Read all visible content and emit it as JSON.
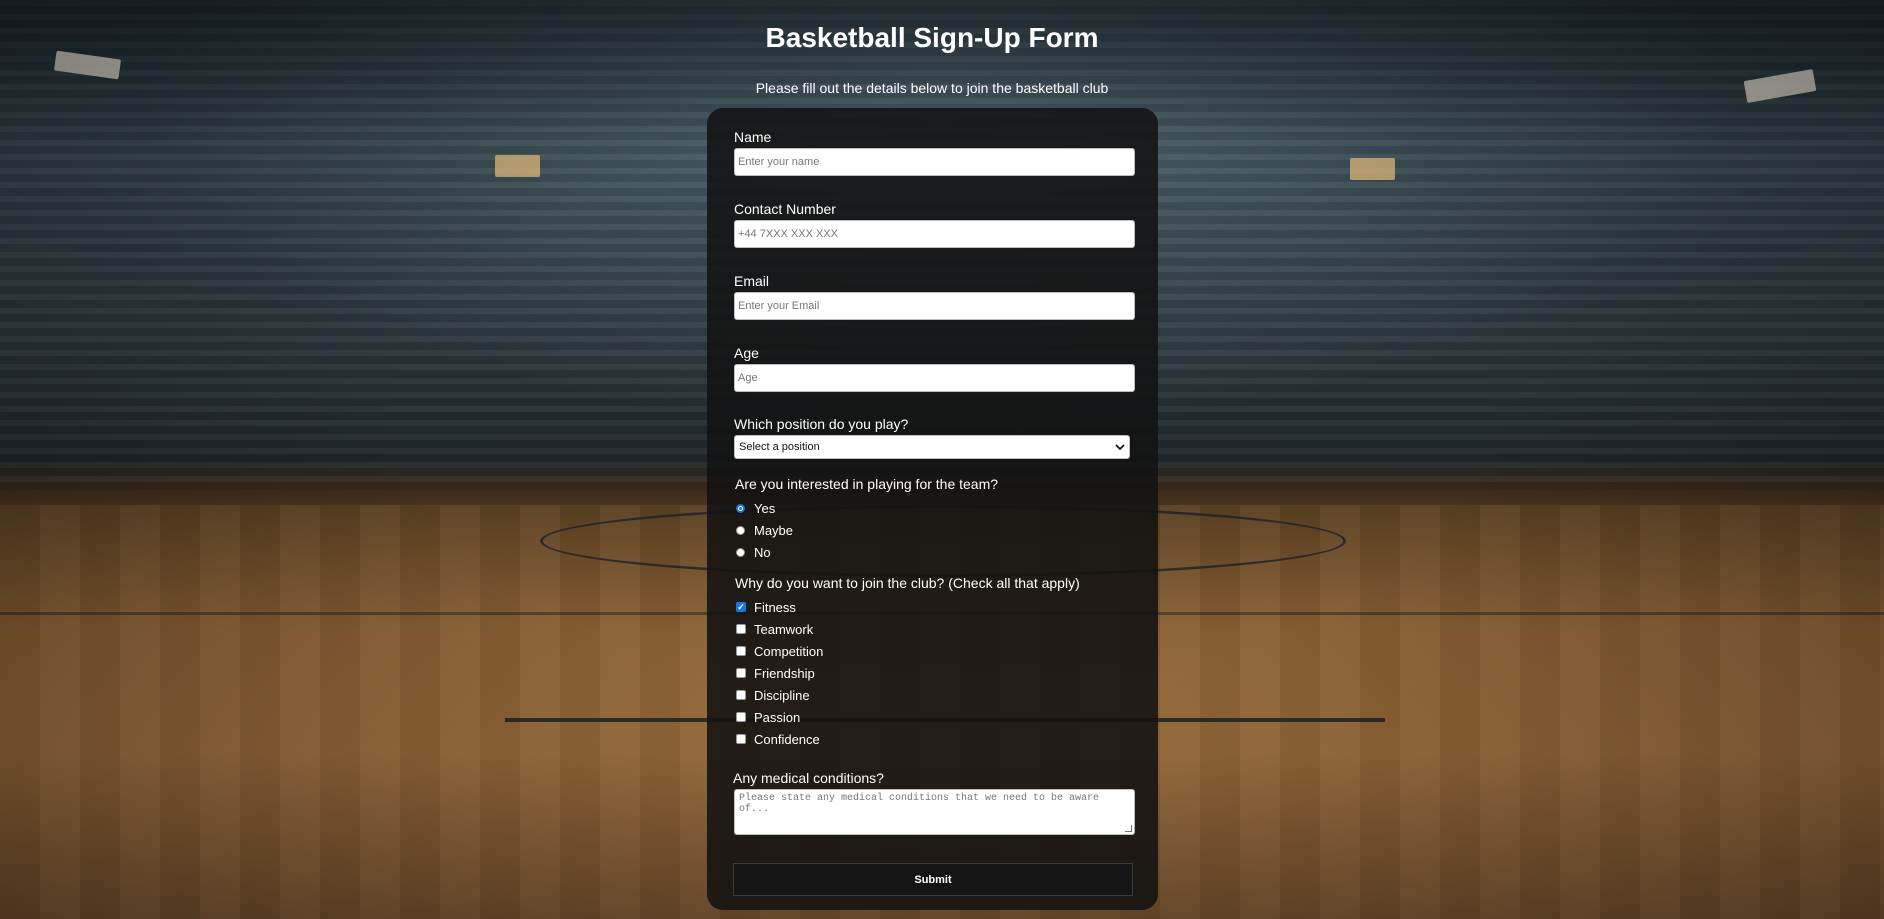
{
  "page": {
    "title": "Basketball Sign-Up Form",
    "subtitle": "Please fill out the details below to join the basketball club"
  },
  "form": {
    "name": {
      "label": "Name",
      "placeholder": "Enter your name",
      "value": ""
    },
    "contact": {
      "label": "Contact Number",
      "placeholder": "+44 7XXX XXX XXX",
      "value": ""
    },
    "email": {
      "label": "Email",
      "placeholder": "Enter your Email",
      "value": ""
    },
    "age": {
      "label": "Age",
      "placeholder": "Age",
      "value": ""
    },
    "position": {
      "label": "Which position do you play?",
      "selected": "Select a position"
    },
    "interest": {
      "label": "Are you interested in playing for the team?",
      "options": [
        "Yes",
        "Maybe",
        "No"
      ],
      "selected": "Yes"
    },
    "reasons": {
      "label": "Why do you want to join the club? (Check all that apply)",
      "options": [
        "Fitness",
        "Teamwork",
        "Competition",
        "Friendship",
        "Discipline",
        "Passion",
        "Confidence"
      ],
      "checked": [
        "Fitness"
      ]
    },
    "medical": {
      "label": "Any medical conditions?",
      "placeholder": "Please state any medical conditions that we need to be aware of..."
    },
    "submit_label": "Submit"
  },
  "colors": {
    "card_background": "#121212",
    "accent": "#1a73e8",
    "text": "#ffffff"
  },
  "icons": {
    "select_arrow": "chevron-down-icon"
  }
}
